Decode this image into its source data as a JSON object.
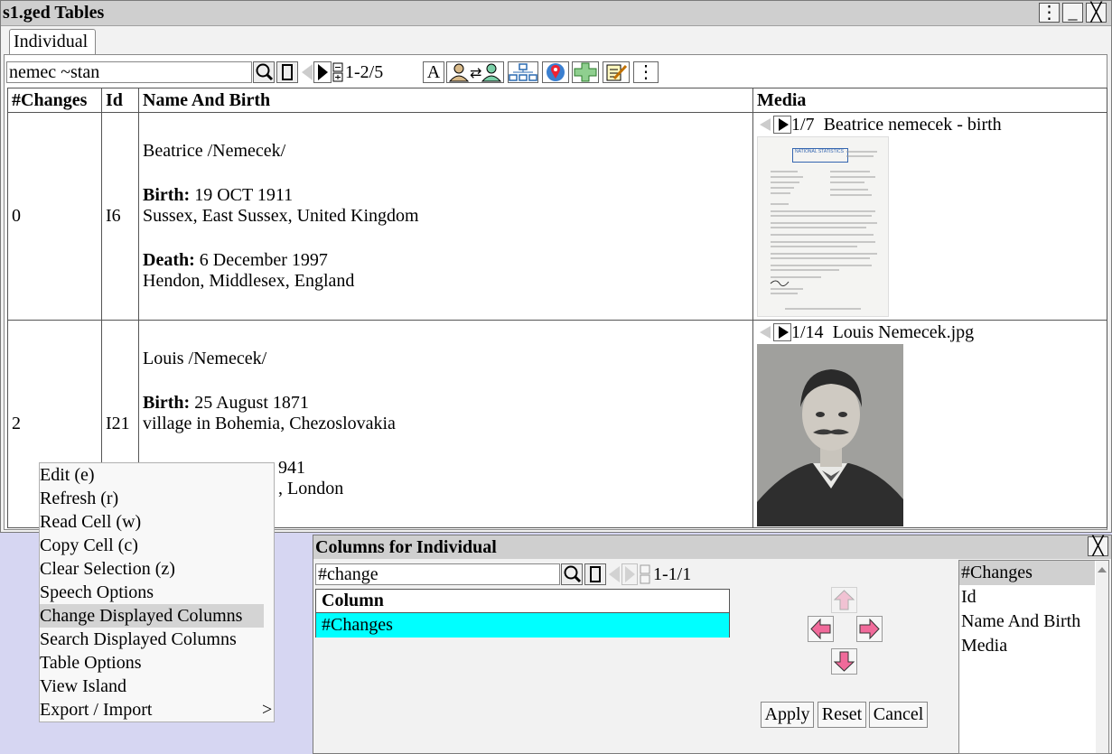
{
  "window": {
    "title": "s1.ged Tables",
    "btn_menu": "⋮",
    "btn_min": "_",
    "btn_close": "╳"
  },
  "tab": {
    "label": "Individual"
  },
  "search": {
    "value": "nemec ~stan",
    "range": "1-2/5",
    "font_btn": "A",
    "more_btn": "⋮"
  },
  "table": {
    "headers": [
      "#Changes",
      "Id",
      "Name And Birth",
      "Media"
    ],
    "rows": [
      {
        "changes": "0",
        "id": "I6",
        "name": "Beatrice /Nemecek/",
        "birth_label": "Birth:",
        "birth_date": "19 OCT 1911",
        "birth_place": "Sussex, East Sussex, United Kingdom",
        "death_label": "Death:",
        "death_date": "6 December 1997",
        "death_place": "Hendon, Middlesex, England",
        "media_count": "1/7",
        "media_title": "Beatrice nemecek - birth",
        "doc_heading": "NATIONAL STATISTICS"
      },
      {
        "changes": "2",
        "id": "I21",
        "name": "Louis /Nemecek/",
        "birth_label": "Birth:",
        "birth_date": "25 August 1871",
        "birth_place": "village in Bohemia, Chezoslovakia",
        "death_date_partial": "941",
        "death_place_partial": ", London",
        "media_count": "1/14",
        "media_title": "Louis Nemecek.jpg"
      }
    ]
  },
  "context_menu": {
    "items": [
      "Edit (e)",
      "Refresh (r)",
      "Read Cell (w)",
      "Copy Cell (c)",
      "Clear Selection (z)",
      "Speech Options",
      "Change Displayed Columns",
      "Search Displayed Columns",
      "Table Options",
      "View Island",
      "Export / Import"
    ],
    "selected_index": 6,
    "submenu_glyph": ">"
  },
  "columns_dialog": {
    "title": "Columns for Individual",
    "close": "╳",
    "search_value": "#change",
    "range": "1-1/1",
    "column_header": "Column",
    "selected_column": "#Changes",
    "all_columns": [
      "#Changes",
      "Id",
      "Name And Birth",
      "Media"
    ],
    "apply": "Apply",
    "reset": "Reset",
    "cancel": "Cancel"
  },
  "colors": {
    "accent_cyan": "#00ffff",
    "arrow_pink": "#f06a9a",
    "titlebar": "#cfcfcf",
    "desktop": "#d6d6f2"
  }
}
